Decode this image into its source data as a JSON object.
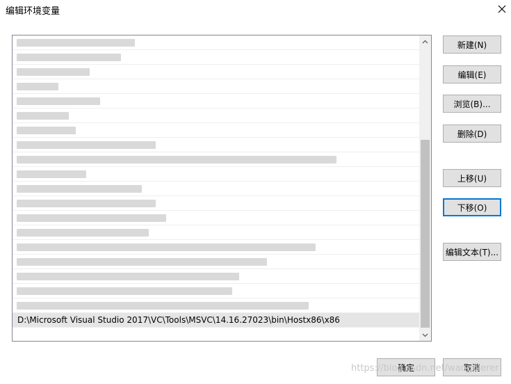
{
  "window": {
    "title": "编辑环境变量"
  },
  "list": {
    "selected_path": "D:\\Microsoft Visual Studio 2017\\VC\\Tools\\MSVC\\14.16.27023\\bin\\Hostx86\\x86"
  },
  "buttons": {
    "new": "新建(N)",
    "edit": "编辑(E)",
    "browse": "浏览(B)...",
    "delete": "删除(D)",
    "move_up": "上移(U)",
    "move_down": "下移(O)",
    "edit_text": "编辑文本(T)...",
    "ok": "确定",
    "cancel": "取消"
  },
  "watermark": "https://blog.csdn.net/wangdierer"
}
